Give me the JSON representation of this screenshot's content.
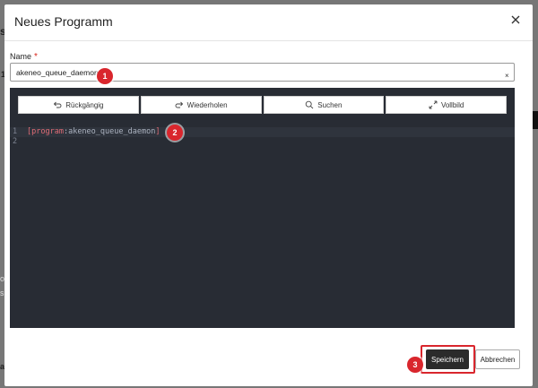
{
  "background": {
    "fragments": [
      "s",
      "1",
      "ol",
      "s",
      "aa",
      "sc"
    ]
  },
  "dialog": {
    "title": "Neues Programm",
    "close_icon": "close-icon"
  },
  "name_field": {
    "label": "Name",
    "required_mark": "*",
    "value": "akeneo_queue_daemon",
    "clear_label": "×"
  },
  "editor": {
    "toolbar": [
      {
        "label": "Rückgängig",
        "icon": "undo-icon"
      },
      {
        "label": "Wiederholen",
        "icon": "redo-icon"
      },
      {
        "label": "Suchen",
        "icon": "search-icon"
      },
      {
        "label": "Vollbild",
        "icon": "fullscreen-icon"
      }
    ],
    "lines": [
      {
        "number": "1",
        "open": "[",
        "key": "program",
        "sep": ":",
        "value": "akeneo_queue_daemon",
        "close": "]"
      },
      {
        "number": "2",
        "text": ""
      }
    ],
    "colors": {
      "background": "#282c34",
      "keyword": "#e06c75",
      "text": "#abb2bf"
    }
  },
  "footer": {
    "save_label": "Speichern",
    "cancel_label": "Abbrechen"
  },
  "markers": [
    "1",
    "2",
    "3"
  ],
  "accent_color": "#d9262d"
}
